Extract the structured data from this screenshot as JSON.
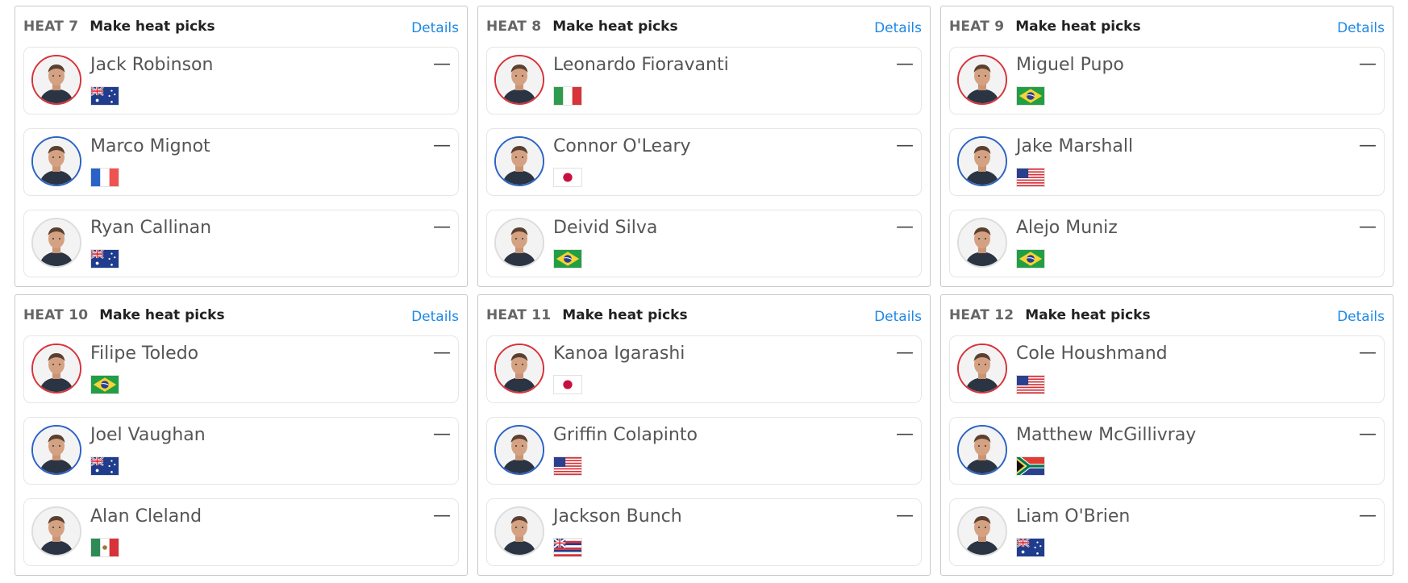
{
  "heats": [
    {
      "number": "HEAT 7",
      "picks_label": "Make heat picks",
      "details_label": "Details",
      "surfers": [
        {
          "name": "Jack Robinson",
          "country": "australia",
          "jersey": "red",
          "pick": "—"
        },
        {
          "name": "Marco Mignot",
          "country": "france",
          "jersey": "blue",
          "pick": "—"
        },
        {
          "name": "Ryan Callinan",
          "country": "australia",
          "jersey": "none",
          "pick": "—"
        }
      ]
    },
    {
      "number": "HEAT 8",
      "picks_label": "Make heat picks",
      "details_label": "Details",
      "surfers": [
        {
          "name": "Leonardo Fioravanti",
          "country": "italy",
          "jersey": "red",
          "pick": "—"
        },
        {
          "name": "Connor O'Leary",
          "country": "japan",
          "jersey": "blue",
          "pick": "—"
        },
        {
          "name": "Deivid Silva",
          "country": "brazil",
          "jersey": "none",
          "pick": "—"
        }
      ]
    },
    {
      "number": "HEAT 9",
      "picks_label": "Make heat picks",
      "details_label": "Details",
      "surfers": [
        {
          "name": "Miguel Pupo",
          "country": "brazil",
          "jersey": "red",
          "pick": "—"
        },
        {
          "name": "Jake Marshall",
          "country": "usa",
          "jersey": "blue",
          "pick": "—"
        },
        {
          "name": "Alejo Muniz",
          "country": "brazil",
          "jersey": "none",
          "pick": "—"
        }
      ]
    },
    {
      "number": "HEAT 10",
      "picks_label": "Make heat picks",
      "details_label": "Details",
      "surfers": [
        {
          "name": "Filipe Toledo",
          "country": "brazil",
          "jersey": "red",
          "pick": "—"
        },
        {
          "name": "Joel Vaughan",
          "country": "australia",
          "jersey": "blue",
          "pick": "—"
        },
        {
          "name": "Alan Cleland",
          "country": "mexico",
          "jersey": "none",
          "pick": "—"
        }
      ]
    },
    {
      "number": "HEAT 11",
      "picks_label": "Make heat picks",
      "details_label": "Details",
      "surfers": [
        {
          "name": "Kanoa Igarashi",
          "country": "japan",
          "jersey": "red",
          "pick": "—"
        },
        {
          "name": "Griffin Colapinto",
          "country": "usa",
          "jersey": "blue",
          "pick": "—"
        },
        {
          "name": "Jackson Bunch",
          "country": "hawaii",
          "jersey": "none",
          "pick": "—"
        }
      ]
    },
    {
      "number": "HEAT 12",
      "picks_label": "Make heat picks",
      "details_label": "Details",
      "surfers": [
        {
          "name": "Cole Houshmand",
          "country": "usa",
          "jersey": "red",
          "pick": "—"
        },
        {
          "name": "Matthew McGillivray",
          "country": "south-africa",
          "jersey": "blue",
          "pick": "—"
        },
        {
          "name": "Liam O'Brien",
          "country": "australia",
          "jersey": "none",
          "pick": "—"
        }
      ]
    }
  ],
  "colors": {
    "link": "#1e88e5",
    "red_jersey": "#d8323a",
    "blue_jersey": "#2a63c7"
  }
}
